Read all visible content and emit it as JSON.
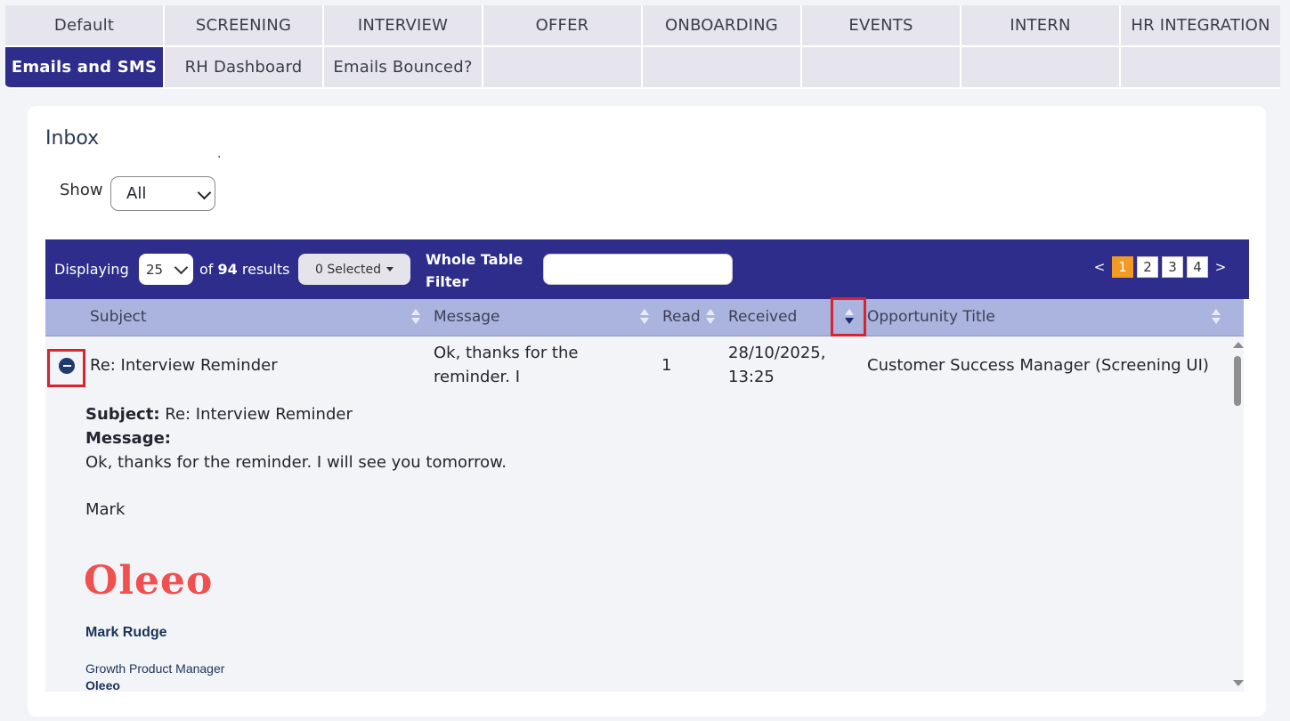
{
  "tabs": {
    "row1": [
      "Default",
      "SCREENING",
      "INTERVIEW",
      "OFFER",
      "ONBOARDING",
      "EVENTS",
      "INTERN",
      "HR INTEGRATION"
    ],
    "row2": [
      "Emails and SMS",
      "RH Dashboard",
      "Emails Bounced?",
      "",
      "",
      "",
      "",
      ""
    ],
    "active": "Emails and SMS"
  },
  "inbox": {
    "title": "Inbox",
    "dot": ".",
    "show_label": "Show",
    "show_value": "All"
  },
  "toolbar": {
    "displaying_label": "Displaying",
    "page_size": "25",
    "of_label": "of",
    "total": "94",
    "results_label": "results",
    "selected_label": "0 Selected",
    "filter_label_1": "Whole Table",
    "filter_label_2": "Filter",
    "filter_value": "",
    "pager": {
      "prev": "<",
      "next": ">",
      "pages": [
        "1",
        "2",
        "3",
        "4"
      ],
      "current": "1"
    }
  },
  "columns": {
    "subject": "Subject",
    "message": "Message",
    "read": "Read",
    "received": "Received",
    "opportunity": "Opportunity Title"
  },
  "row": {
    "subject": "Re: Interview Reminder",
    "message_line1": "Ok, thanks for the",
    "message_line2": "reminder. I",
    "read": "1",
    "received_line1": "28/10/2025,",
    "received_line2": "13:25",
    "opportunity": "Customer Success Manager (Screening UI)"
  },
  "detail": {
    "subject_label": "Subject:",
    "subject_value": "Re: Interview Reminder",
    "message_label": "Message:",
    "message_body": "Ok, thanks for the reminder. I will see you tomorrow.",
    "sign_off": "Mark",
    "logo_text": "Oleeo",
    "sig_name": "Mark Rudge",
    "sig_role": "Growth Product Manager",
    "sig_company": "Oleeo"
  },
  "colors": {
    "primary": "#2e2d8c",
    "header_row": "#aab4de",
    "active_page": "#f29b24",
    "highlight": "#d9232e",
    "logo": "#f0504f"
  }
}
